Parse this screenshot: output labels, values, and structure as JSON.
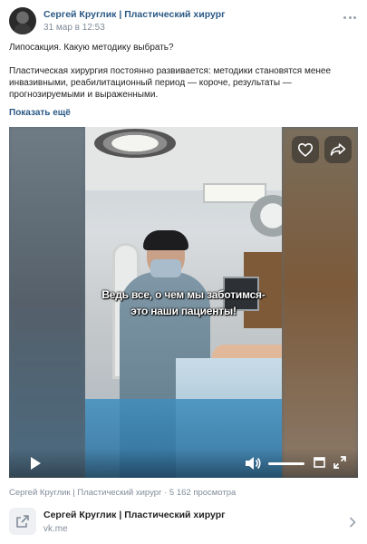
{
  "post": {
    "author": "Сергей Круглик | Пластический хирург",
    "date": "31 мар в 12:53",
    "title_line": "Липосакция. Какую методику выбрать?",
    "body": "Пластическая хирургия постоянно развивается: методики становятся менее инвазивными, реабилитационный период — короче, результаты — прогнозируемыми и выраженными.",
    "show_more": "Показать ещё"
  },
  "video": {
    "subtitle_line1": "Ведь все, о чем мы заботимся-",
    "subtitle_line2": "это наши пациенты!",
    "meta": "Сергей Круглик | Пластический хирург · 5 162 просмотра",
    "volume_level": 1.0
  },
  "link_card": {
    "title": "Сергей Круглик | Пластический хирург",
    "domain": "vk.me"
  },
  "icons": {
    "more": "more-horizontal-icon",
    "like": "heart-icon",
    "share": "share-icon",
    "play": "play-icon",
    "volume": "volume-icon",
    "pip": "picture-in-picture-icon",
    "fullscreen": "fullscreen-icon",
    "link": "external-link-icon",
    "chevron": "chevron-right-icon"
  },
  "colors": {
    "link_blue": "#2a5885",
    "secondary_text": "#818c99"
  }
}
